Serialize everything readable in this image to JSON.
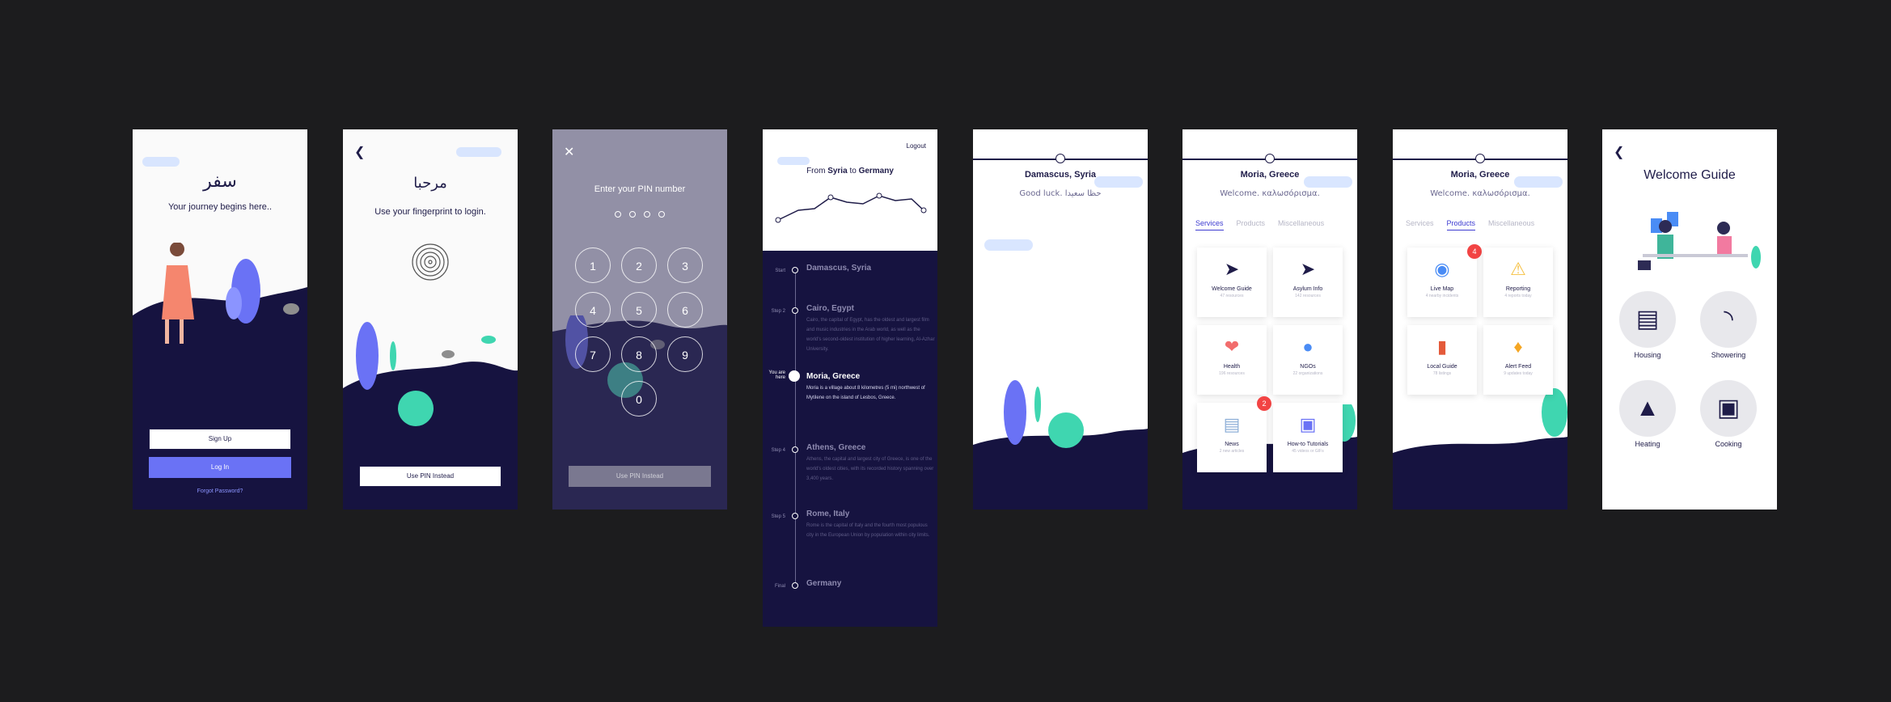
{
  "screen1": {
    "title_ar": "سفر",
    "tagline": "Your journey begins here..",
    "signup": "Sign Up",
    "login": "Log In",
    "forgot": "Forgot Password?"
  },
  "screen2": {
    "title_ar": "مرحبا",
    "tagline": "Use your fingerprint to login.",
    "pin_button": "Use PIN Instead"
  },
  "screen3": {
    "prompt": "Enter your PIN number",
    "keys": [
      "1",
      "2",
      "3",
      "4",
      "5",
      "6",
      "7",
      "8",
      "9",
      "0"
    ],
    "pin_button": "Use PIN Instead"
  },
  "screen4": {
    "logout": "Logout",
    "from_prefix": "From",
    "from": "Syria",
    "to_word": "to",
    "to": "Germany",
    "steps": [
      {
        "label": "Start",
        "title": "Damascus, Syria",
        "desc": ""
      },
      {
        "label": "Step 2",
        "title": "Cairo, Egypt",
        "desc": "Cairo, the capital of Egypt, has the oldest and largest film and music industries in the Arab world, as well as the world's second-oldest institution of higher learning, Al-Azhar University."
      },
      {
        "label": "You are here",
        "title": "Moria, Greece",
        "desc": "Moria is a village about 8 kilometres (5 mi) northwest of Mytilene on the island of Lesbos, Greece."
      },
      {
        "label": "Step 4",
        "title": "Athens, Greece",
        "desc": "Athens, the capital and largest city of Greece, is one of the world's oldest cities, with its recorded history spanning over 3,400 years."
      },
      {
        "label": "Step 5",
        "title": "Rome, Italy",
        "desc": "Rome is the capital of Italy and the fourth most populous city in the European Union by population within city limits."
      },
      {
        "label": "Final",
        "title": "Germany",
        "desc": ""
      }
    ]
  },
  "screen5": {
    "city": "Damascus, Syria",
    "greeting": "Good luck. حظا سعيدا"
  },
  "screen6": {
    "city": "Moria, Greece",
    "greeting": "Welcome. καλωσόρισμα.",
    "tabs": [
      "Services",
      "Products",
      "Miscellaneous"
    ],
    "cards": [
      {
        "title": "Welcome Guide",
        "sub": "47 resources",
        "icon": "signpost-icon"
      },
      {
        "title": "Asylum Info",
        "sub": "142 resources",
        "icon": "signpost-icon"
      },
      {
        "title": "Health",
        "sub": "196 resources",
        "icon": "heart-hand-icon"
      },
      {
        "title": "NGOs",
        "sub": "22 organizations",
        "icon": "whale-icon"
      },
      {
        "title": "News",
        "sub": "2 new articles",
        "icon": "newspaper-icon"
      },
      {
        "title": "How-to Tutorials",
        "sub": "45 videos or GIFs",
        "icon": "tutorial-icon"
      }
    ],
    "news_badge": "2"
  },
  "screen7": {
    "city": "Moria, Greece",
    "greeting": "Welcome. καλωσόρισμα.",
    "tabs": [
      "Services",
      "Products",
      "Miscellaneous"
    ],
    "cards": [
      {
        "title": "Live Map",
        "sub": "4 nearby incidents",
        "icon": "globe-icon"
      },
      {
        "title": "Reporting",
        "sub": "4 reports today",
        "icon": "warning-icon"
      },
      {
        "title": "Local Guide",
        "sub": "78 listings",
        "icon": "book-pin-icon"
      },
      {
        "title": "Alert Feed",
        "sub": "9 updates today",
        "icon": "bell-icon"
      }
    ],
    "map_badge": "4"
  },
  "screen8": {
    "title": "Welcome Guide",
    "items": [
      {
        "label": "Housing",
        "icon": "bed-icon"
      },
      {
        "label": "Showering",
        "icon": "bathtub-icon"
      },
      {
        "label": "Heating",
        "icon": "heater-icon"
      },
      {
        "label": "Cooking",
        "icon": "stove-icon"
      }
    ]
  }
}
